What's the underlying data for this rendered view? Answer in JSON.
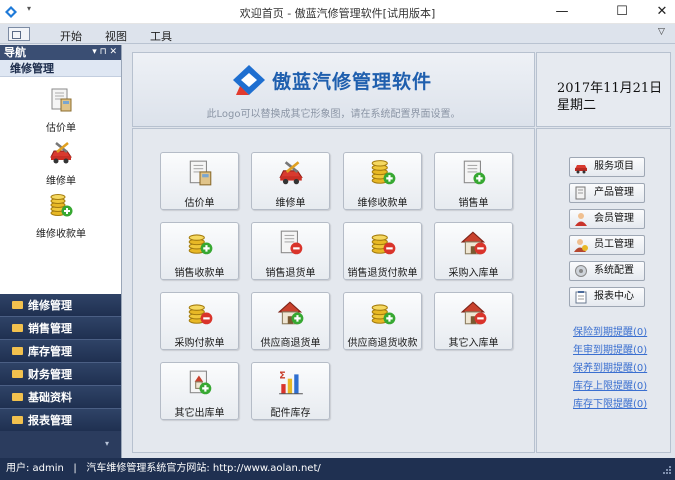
{
  "window": {
    "title": "欢迎首页 - 傲蓝汽修管理软件[试用版本]",
    "min_glyph": "—",
    "max_glyph": "☐",
    "close_glyph": "✕",
    "qa_arrow": "▾"
  },
  "menu": {
    "items": [
      "开始",
      "视图",
      "工具"
    ],
    "collapse_glyph": "▽"
  },
  "nav": {
    "header": "导航",
    "header_buttons": "▾ ⊓ ✕",
    "group_title": "维修管理",
    "tools": [
      {
        "label": "估价单",
        "icon": "document-calculator-icon"
      },
      {
        "label": "维修单",
        "icon": "car-tools-icon"
      },
      {
        "label": "维修收款单",
        "icon": "coins-add-icon"
      }
    ],
    "sections": [
      "维修管理",
      "销售管理",
      "库存管理",
      "财务管理",
      "基础资料",
      "报表管理"
    ],
    "bottom_glyph": "▾"
  },
  "banner": {
    "logo_text": "傲蓝汽修管理软件",
    "hint": "此Logo可以替换成其它形象图，请在系统配置界面设置。"
  },
  "date": {
    "date": "2017年11月21日",
    "weekday": "星期二"
  },
  "tiles": [
    {
      "label": "估价单",
      "icon": "document-calculator-icon"
    },
    {
      "label": "维修单",
      "icon": "car-tools-icon"
    },
    {
      "label": "维修收款单",
      "icon": "coins-add-icon"
    },
    {
      "label": "销售单",
      "icon": "document-add-icon"
    },
    {
      "label": "销售收款单",
      "icon": "coins-add-icon"
    },
    {
      "label": "销售退货单",
      "icon": "document-remove-icon"
    },
    {
      "label": "销售退货付款单",
      "icon": "coins-remove-icon"
    },
    {
      "label": "采购入库单",
      "icon": "warehouse-remove-icon"
    },
    {
      "label": "采购付款单",
      "icon": "coins-remove-icon"
    },
    {
      "label": "供应商退货单",
      "icon": "warehouse-add-icon"
    },
    {
      "label": "供应商退货收款",
      "icon": "coins-add-icon"
    },
    {
      "label": "其它入库单",
      "icon": "warehouse-remove-icon"
    },
    {
      "label": "其它出库单",
      "icon": "document-add-icon"
    },
    {
      "label": "配件库存",
      "icon": "bar-chart-icon"
    }
  ],
  "side_buttons": [
    {
      "label": "服务项目",
      "icon": "service-icon"
    },
    {
      "label": "产品管理",
      "icon": "product-icon"
    },
    {
      "label": "会员管理",
      "icon": "member-icon"
    },
    {
      "label": "员工管理",
      "icon": "employee-icon"
    },
    {
      "label": "系统配置",
      "icon": "config-icon"
    },
    {
      "label": "报表中心",
      "icon": "report-icon"
    }
  ],
  "side_links": [
    "保险到期提醒(0)",
    "年审到期提醒(0)",
    "保养到期提醒(0)",
    "库存上限提醒(0)",
    "库存下限提醒(0)"
  ],
  "status": {
    "text": "用户: admin   |   汽车维修管理系统官方网站: http://www.aolan.net/"
  },
  "colors": {
    "nav_dark": "#1f3051",
    "logo_blue": "#1f5fae",
    "link_blue": "#3a6fd0",
    "coin_gold": "#e8b825",
    "add_green": "#37a832",
    "remove_red": "#d9342b"
  }
}
